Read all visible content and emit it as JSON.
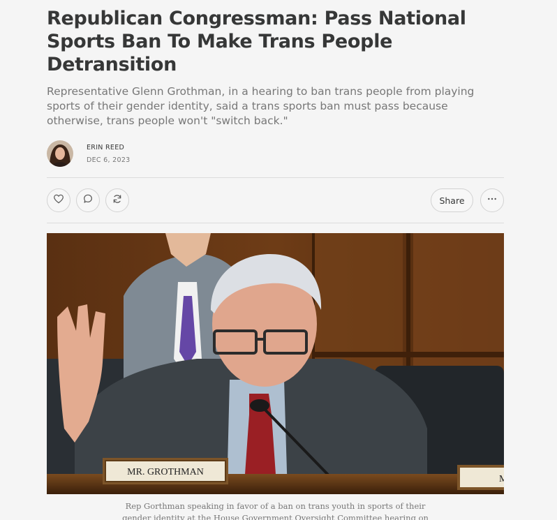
{
  "post": {
    "title": "Republican Congressman: Pass National Sports Ban To Make Trans People Detransition",
    "subtitle": "Representative Glenn Grothman, in a hearing to ban trans people from playing sports of their gender identity, said a trans sports ban must pass because otherwise, trans people won't \"switch back.\"",
    "author": "ERIN REED",
    "date": "DEC 6, 2023"
  },
  "actions": {
    "like_icon": "heart-icon",
    "comment_icon": "comment-icon",
    "restack_icon": "restack-icon",
    "share_label": "Share",
    "more_icon": "more-icon"
  },
  "hero": {
    "nameplate": "MR. GROTHMAN",
    "nameplate_edge": "M",
    "caption": "Rep Gorthman speaking in favor of a ban on trans youth in sports of their gender identity at the House Government Oversight Committee hearing on Biden’s Title IX policy."
  }
}
